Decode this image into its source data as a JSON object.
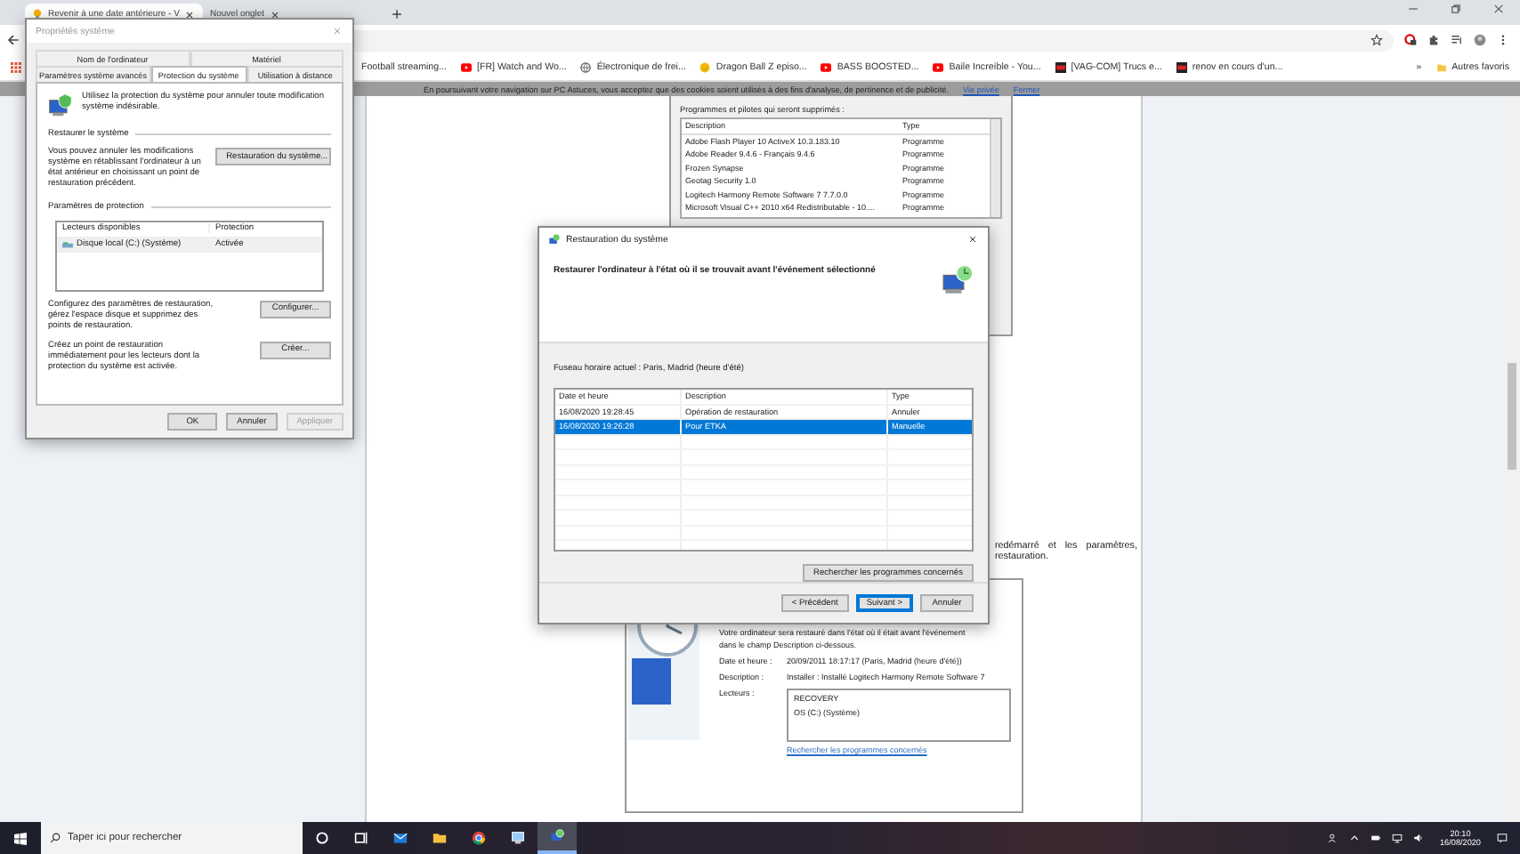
{
  "browser": {
    "tabs": [
      {
        "title": "Revenir à une date antérieure - V",
        "selected": true
      },
      {
        "title": "Nouvel onglet",
        "selected": false
      }
    ],
    "bookmarks": [
      {
        "label": "Football streaming..."
      },
      {
        "label": "[FR] Watch and Wo..."
      },
      {
        "label": "Électronique de frei..."
      },
      {
        "label": "Dragon Ball Z episo..."
      },
      {
        "label": "BASS BOOSTED..."
      },
      {
        "label": "Baile Increíble - You..."
      },
      {
        "label": "[VAG-COM] Trucs e..."
      },
      {
        "label": "renov en cours d'un..."
      }
    ],
    "overflow": "»",
    "other_bookmarks": "Autres favoris"
  },
  "cookie_banner": {
    "text": "En poursuivant votre navigation sur PC Astuces, vous acceptez que des cookies soient utilisés à des fins d'analyse, de pertinence et de publicité.",
    "links": [
      "Vie privée",
      "Fermer"
    ]
  },
  "article": {
    "programs_screenshot": {
      "title": "Programmes et pilotes qui seront supprimés :",
      "columns": [
        "Description",
        "Type"
      ],
      "rows": [
        [
          "Adobe Flash Player 10 ActiveX 10.3.183.10",
          "Programme"
        ],
        [
          "Adobe Reader 9.4.6 - Français 9.4.6",
          "Programme"
        ],
        [
          "Frozen Synapse",
          "Programme"
        ],
        [
          "Geotag Security 1.0",
          "Programme"
        ],
        [
          "Logitech Harmony Remote Software 7 7.7.0.0",
          "Programme"
        ],
        [
          "Microsoft Visual C++ 2010  x64 Redistributable - 10....",
          "Programme"
        ]
      ]
    },
    "paragraph_lines": [
      "redémarré et les paramètres,",
      "restauration."
    ],
    "confirm_screenshot": {
      "intro": [
        "Votre ordinateur sera restauré dans l'état où il était avant l'événement",
        "dans le champ Description ci-dessous."
      ],
      "fields": [
        {
          "label": "Date et heure :",
          "value": "20/09/2011 18:17:17 (Paris, Madrid (heure d'été))"
        },
        {
          "label": "Description :",
          "value": "Installer : Installé Logitech Harmony Remote Software 7"
        }
      ],
      "drives_label": "Lecteurs :",
      "drives": [
        "RECOVERY",
        "OS (C:) (Système)"
      ],
      "link": "Rechercher les programmes concernés"
    }
  },
  "system_properties": {
    "title": "Propriétés système",
    "tab_rows": [
      [
        {
          "label": "Nom de l'ordinateur",
          "selected": false
        },
        {
          "label": "Matériel",
          "selected": false
        }
      ],
      [
        {
          "label": "Paramètres système avancés",
          "selected": false
        },
        {
          "label": "Protection du système",
          "selected": true
        },
        {
          "label": "Utilisation à distance",
          "selected": false
        }
      ]
    ],
    "intro": "Utilisez la protection du système pour annuler toute modification système indésirable.",
    "restore_section": "Restaurer le système",
    "restore_text": "Vous pouvez annuler les modifications système en rétablissant l'ordinateur à un état antérieur en choisissant un point de restauration précédent.",
    "restore_button": "Restauration du système...",
    "protection_section": "Paramètres de protection",
    "columns": [
      "Lecteurs disponibles",
      "Protection"
    ],
    "drives": [
      {
        "name": "Disque local (C:) (Système)",
        "protection": "Activée"
      }
    ],
    "configure_text": "Configurez des paramètres de restauration, gérez l'espace disque et supprimez des points de restauration.",
    "configure_button": "Configurer...",
    "create_text": "Créez un point de restauration immédiatement pour les lecteurs dont la protection du système est activée.",
    "create_button": "Créer...",
    "buttons": [
      {
        "label": "OK",
        "disabled": false
      },
      {
        "label": "Annuler",
        "disabled": false
      },
      {
        "label": "Appliquer",
        "disabled": true
      }
    ]
  },
  "restore_dialog": {
    "title": "Restauration du système",
    "heading": "Restaurer l'ordinateur à l'état où il se trouvait avant l'événement sélectionné",
    "timezone": "Fuseau horaire actuel : Paris, Madrid (heure d'été)",
    "columns": [
      "Date et heure",
      "Description",
      "Type"
    ],
    "rows": [
      {
        "date": "16/08/2020 19:28:45",
        "description": "Opération de restauration",
        "type": "Annuler",
        "selected": false
      },
      {
        "date": "16/08/2020 19:26:28",
        "description": "Pour ETKA",
        "type": "Manuelle",
        "selected": true
      }
    ],
    "search_button": "Rechercher les programmes concernés",
    "buttons": [
      {
        "label": "< Précédent",
        "default": false
      },
      {
        "label": "Suivant >",
        "default": true
      },
      {
        "label": "Annuler",
        "default": false
      }
    ]
  },
  "taskbar": {
    "search_placeholder": "Taper ici pour rechercher",
    "apps": [
      {
        "kind": "cortana",
        "selected": false
      },
      {
        "kind": "taskview",
        "selected": false
      },
      {
        "kind": "mail",
        "selected": false
      },
      {
        "kind": "folder",
        "selected": false
      },
      {
        "kind": "chrome",
        "selected": false
      },
      {
        "kind": "network",
        "selected": false
      },
      {
        "kind": "restore",
        "selected": true
      }
    ],
    "time": "20:10",
    "date": "16/08/2020"
  }
}
